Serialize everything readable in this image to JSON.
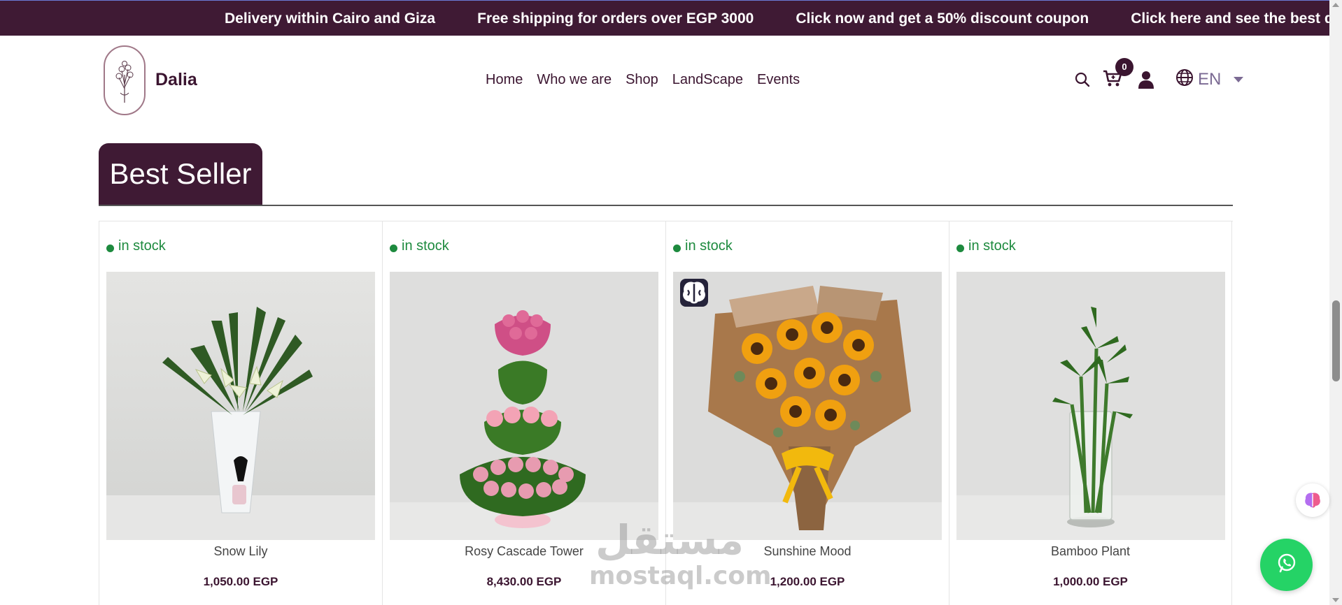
{
  "announcement_bar": {
    "messages": [
      "Delivery within Cairo and Giza",
      "Free shipping for orders over EGP 3000",
      "Click now and get a 50% discount coupon",
      "Click here and see the best discoun"
    ]
  },
  "header": {
    "brand_name": "Dalia",
    "logo_icon": "bouquet-logo-icon",
    "nav": [
      "Home",
      "Who we are",
      "Shop",
      "LandScape",
      "Events"
    ],
    "cart_count": "0",
    "language": "EN",
    "icons": [
      "search-icon",
      "cart-icon",
      "user-icon",
      "globe-icon",
      "caret-down-icon"
    ]
  },
  "section": {
    "title": "Best Seller"
  },
  "products": [
    {
      "stock": "in stock",
      "name": "Snow Lily",
      "price": "1,050.00 EGP"
    },
    {
      "stock": "in stock",
      "name": "Rosy Cascade Tower",
      "price": "8,430.00 EGP"
    },
    {
      "stock": "in stock",
      "name": "Sunshine Mood",
      "price": "1,200.00 EGP"
    },
    {
      "stock": "in stock",
      "name": "Bamboo Plant",
      "price": "1,000.00 EGP"
    }
  ],
  "watermark": {
    "arabic": "مستقل",
    "latin": "mostaql.com"
  },
  "colors": {
    "brand": "#3f1a34",
    "stock_green": "#1d8a3e",
    "whatsapp": "#25d366"
  }
}
